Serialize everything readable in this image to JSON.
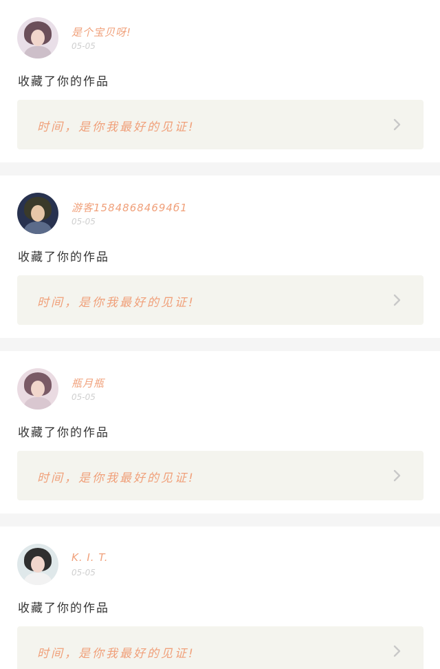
{
  "theme": {
    "accent": "#f0a07a",
    "muted": "#cfcfcf",
    "card_bg": "#f4f4ee",
    "separator": "#f5f5f5"
  },
  "feed": [
    {
      "user_name": "是个宝贝呀!",
      "time": "05-05",
      "action": "收藏了你的作品",
      "work_title": "时间，是你我最好的见证!",
      "avatar_icon": "avatar-icon",
      "chevron_icon": "chevron-right-icon"
    },
    {
      "user_name": "游客15848684694б1",
      "time": "05-05",
      "action": "收藏了你的作品",
      "work_title": "时间，是你我最好的见证!",
      "avatar_icon": "avatar-icon",
      "chevron_icon": "chevron-right-icon"
    },
    {
      "user_name": "瓶月瓶",
      "time": "05-05",
      "action": "收藏了你的作品",
      "work_title": "时间，是你我最好的见证!",
      "avatar_icon": "avatar-icon",
      "chevron_icon": "chevron-right-icon"
    },
    {
      "user_name": "K. I. T.",
      "time": "05-05",
      "action": "收藏了你的作品",
      "work_title": "时间，是你我最好的见证!",
      "avatar_icon": "avatar-icon",
      "chevron_icon": "chevron-right-icon"
    }
  ]
}
